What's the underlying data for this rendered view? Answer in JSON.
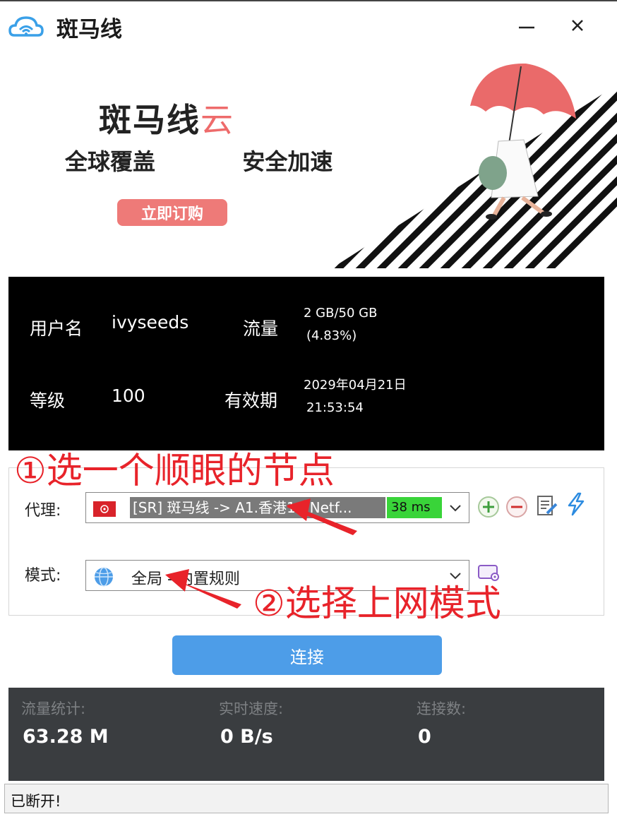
{
  "window": {
    "title": "斑马线",
    "minimize_icon": "minimize-icon",
    "close_icon": "close-icon"
  },
  "banner": {
    "brand_main": "斑马线",
    "brand_accent": "云",
    "slogan": "全球覆盖   安全加速",
    "buy_button": "立即订购",
    "accent_color": "#ee6b6b"
  },
  "account": {
    "username_label": "用户名",
    "username_value": "ivyseeds",
    "traffic_label": "流量",
    "traffic_value": "2 GB/50 GB",
    "traffic_percent": "(4.83%)",
    "level_label": "等级",
    "level_value": "100",
    "expiry_label": "有效期",
    "expiry_date": "2029年04月21日",
    "expiry_time": "21:53:54"
  },
  "settings": {
    "proxy_label": "代理:",
    "proxy_value": "[SR] 斑马线 -> A1.香港1 - Netf...",
    "proxy_latency": "38 ms",
    "proxy_flag": "hong-kong-flag-icon",
    "mode_label": "模式:",
    "mode_value": "全局 - 内置规则",
    "mode_icon": "globe-icon",
    "tools": [
      "add-icon",
      "remove-icon",
      "edit-icon",
      "lightning-icon",
      "rules-icon"
    ]
  },
  "annotations": {
    "step1": "①选一个顺眼的节点",
    "step2": "②选择上网模式",
    "color": "#e8232a"
  },
  "connect": {
    "label": "连接",
    "color": "#4d9de8"
  },
  "stats": {
    "traffic_label": "流量统计:",
    "traffic_value": "63.28 M",
    "speed_label": "实时速度:",
    "speed_value": "0 B/s",
    "connections_label": "连接数:",
    "connections_value": "0"
  },
  "status": {
    "text": "已断开!"
  }
}
